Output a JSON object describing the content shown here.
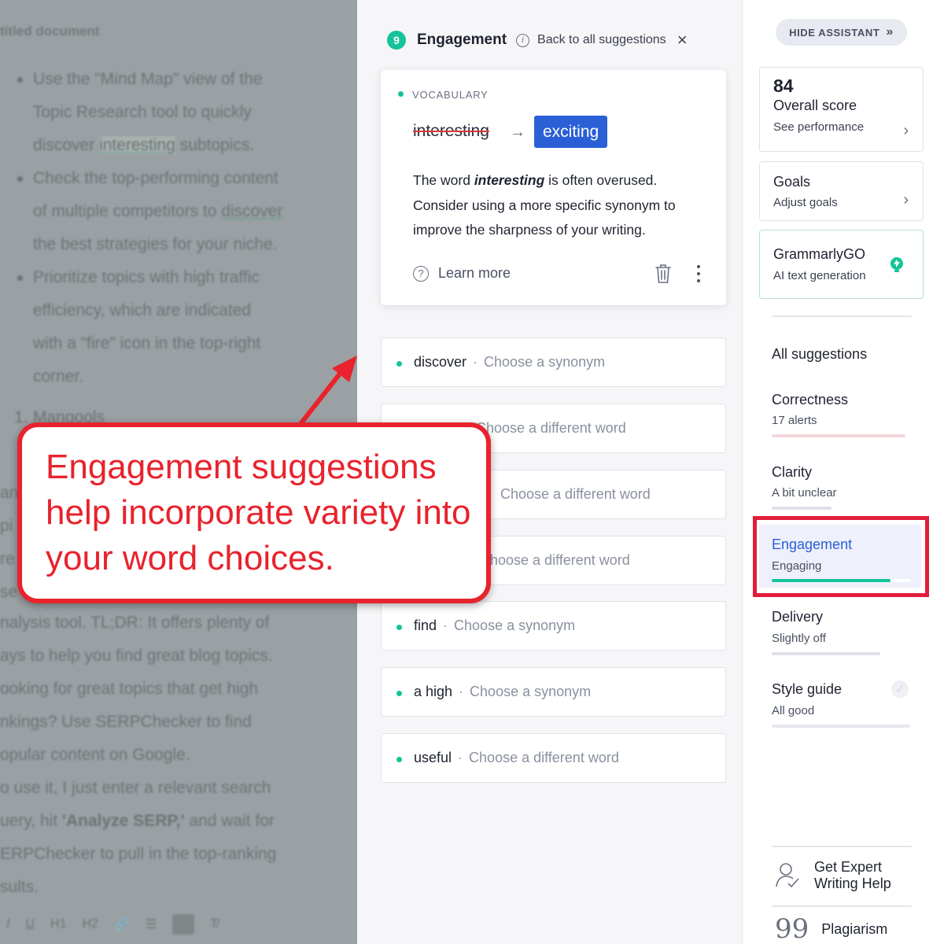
{
  "editor": {
    "title": "titled document",
    "lines": [
      "Use the \"Mind Map\" view of the",
      "Topic Research tool to quickly",
      "discover ",
      "interesting",
      " subtopics.",
      "Check the top-performing content",
      "of multiple competitors to ",
      "discover",
      "the best strategies for your niche.",
      "Prioritize topics with high traffic",
      "efficiency, which are indicated",
      "with a \"fire\" icon in the top-right",
      "corner.",
      "1.",
      "Mangools",
      "an",
      "pi",
      "re",
      "se",
      "nalysis tool. TL;DR: It offers plenty of",
      "ays to help you find great blog topics.",
      "ooking for great topics that get high",
      "nkings? Use SERPChecker to find",
      "opular content on Google.",
      "o use it, I just enter a relevant search",
      "uery, hit ",
      "'Analyze SERP,'",
      " and wait for",
      "ERPChecker to pull in the top-ranking",
      "sults."
    ],
    "toolbar": [
      "I",
      "U",
      "H1",
      "H2",
      "🔗",
      "☰",
      "T̸"
    ]
  },
  "panel": {
    "badge": "9",
    "title": "Engagement",
    "back_link": "Back to all suggestions",
    "close": "×",
    "main_card": {
      "category": "VOCABULARY",
      "original": "interesting",
      "replacement": "exciting",
      "explain_pre": "The word ",
      "explain_word": "interesting",
      "explain_post": " is often overused. Consider using a more specific synonym to improve the sharpness of your writing.",
      "learn_more": "Learn more"
    },
    "suggestions": [
      {
        "word": "discover",
        "hint": "Choose a synonym"
      },
      {
        "word": "",
        "hint": "Choose a different word"
      },
      {
        "word": "",
        "hint": "Choose a different word"
      },
      {
        "word": "",
        "hint": "hoose a different word"
      },
      {
        "word": "find",
        "hint": "Choose a synonym"
      },
      {
        "word": "a high",
        "hint": "Choose a synonym"
      },
      {
        "word": "useful",
        "hint": "Choose a different word"
      }
    ]
  },
  "sidebar": {
    "hide_assistant": "HIDE ASSISTANT",
    "score": {
      "value": "84",
      "title": "Overall score",
      "link": "See performance"
    },
    "goals": {
      "title": "Goals",
      "link": "Adjust goals"
    },
    "go": {
      "title": "GrammarlyGO",
      "sub": "AI text generation"
    },
    "all_suggestions": "All suggestions",
    "categories": [
      {
        "title": "Correctness",
        "sub": "17 alerts",
        "color": "#f4d7db"
      },
      {
        "title": "Clarity",
        "sub": "A bit unclear",
        "color": "#dfe1e8"
      },
      {
        "title": "Engagement",
        "sub": "Engaging",
        "color": "#15c39a",
        "fill": 0.86
      },
      {
        "title": "Delivery",
        "sub": "Slightly off",
        "color": "#dfe1e8"
      },
      {
        "title": "Style guide",
        "sub": "All good",
        "color": "#e6e8ee"
      }
    ],
    "expert": "Get Expert Writing Help",
    "expert_line1": "Get Expert",
    "expert_line2": "Writing Help",
    "plagiarism": "Plagiarism"
  },
  "callout": {
    "text": "Engagement suggestions help incorporate variety into your word choices."
  },
  "colors": {
    "accent_green": "#15c39a",
    "accent_blue": "#2a5fd6",
    "annotation_red": "#e8232d"
  }
}
